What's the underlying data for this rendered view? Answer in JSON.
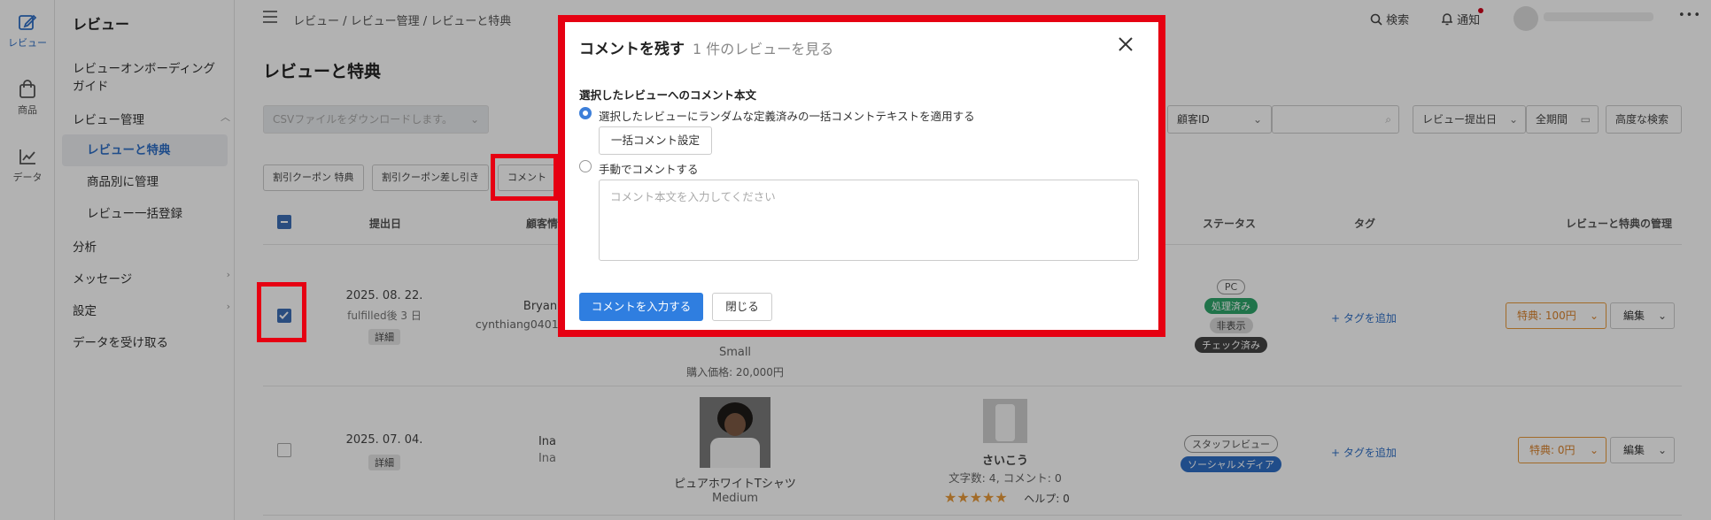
{
  "rail": [
    {
      "label": "レビュー",
      "icon": "edit-icon"
    },
    {
      "label": "商品",
      "icon": "bag-icon"
    },
    {
      "label": "データ",
      "icon": "chart-icon"
    }
  ],
  "sidebar": {
    "title": "レビュー",
    "onboarding": "レビューオンボーディングガイド",
    "manage": "レビュー管理",
    "sub": [
      "レビューと特典",
      "商品別に管理",
      "レビュー一括登録"
    ],
    "analysis": "分析",
    "message": "メッセージ",
    "settings": "設定",
    "receive": "データを受け取る"
  },
  "topbar": {
    "breadcrumb": "レビュー / レビュー管理 / レビューと特典",
    "search": "検索",
    "notify": "通知",
    "more": "•••"
  },
  "page": {
    "title": "レビューと特典",
    "csv": "CSVファイルをダウンロードします。",
    "customer_id": "顧客ID",
    "date_type": "レビュー提出日",
    "period": "全期間",
    "advanced": "高度な検索",
    "actions": [
      "割引クーポン 特典",
      "割引クーポン差し引き",
      "コメント"
    ]
  },
  "table": {
    "headers": {
      "date": "提出日",
      "customer": "顧客情",
      "status": "ステータス",
      "tag": "タグ",
      "manage": "レビューと特典の管理"
    },
    "rows": [
      {
        "date": "2025. 08. 22.",
        "fulfilled": "fulfilled後 3 日",
        "detail": "詳細",
        "customer": "Bryan",
        "email": "cynthiang0401@",
        "product_size": "Small",
        "price": "購入価格: 20,000円",
        "status_tags": [
          "PC",
          "処理済み",
          "非表示",
          "チェック済み"
        ],
        "tag_add": "+ タグを追加",
        "bonus": "特典: 100円",
        "edit": "編集"
      },
      {
        "date": "2025. 07. 04.",
        "detail": "詳細",
        "customer": "Ina",
        "customer_sub": "Ina",
        "product_name": "ピュアホワイトTシャツ",
        "product_size": "Medium",
        "reviewer": "さいこう",
        "chars": "文字数: 4, コメント: 0",
        "rating": 5,
        "help": "ヘルプ: 0",
        "status_tags": [
          "スタッフレビュー",
          "ソーシャルメディア"
        ],
        "tag_add": "+ タグを追加",
        "bonus": "特典: 0円",
        "edit": "編集"
      }
    ]
  },
  "modal": {
    "title": "コメントを残す",
    "subtitle": "1 件のレビューを見る",
    "section_label": "選択したレビューへのコメント本文",
    "option_random": "選択したレビューにランダムな定義済みの一括コメントテキストを適用する",
    "bulk_setting": "一括コメント設定",
    "option_manual": "手動でコメントする",
    "textarea_placeholder": "コメント本文を入力してください",
    "submit": "コメントを入力する",
    "close": "閉じる"
  }
}
